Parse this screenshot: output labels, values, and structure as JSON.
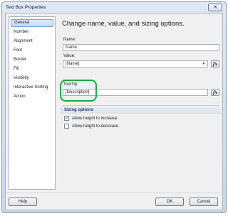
{
  "window": {
    "title": "Text Box Properties",
    "close_glyph": "✕"
  },
  "sidebar": {
    "items": [
      {
        "label": "General",
        "selected": true
      },
      {
        "label": "Number"
      },
      {
        "label": "Alignment"
      },
      {
        "label": "Font"
      },
      {
        "label": "Border"
      },
      {
        "label": "Fill"
      },
      {
        "label": "Visibility"
      },
      {
        "label": "Interactive Sorting"
      },
      {
        "label": "Action"
      }
    ]
  },
  "general": {
    "heading": "Change name, value, and sizing options.",
    "name_label": "Name:",
    "name_value": "Name",
    "value_label": "Value:",
    "value_value": "[Name]",
    "tooltip_label": "ToolTip:",
    "tooltip_value": "[Description]",
    "expression_button": "fx",
    "dropdown_arrow": "▼"
  },
  "sizing": {
    "title": "Sizing options",
    "allow_increase_label": "Allow height to increase",
    "allow_increase_checked": true,
    "allow_decrease_label": "Allow height to decrease",
    "allow_decrease_checked": false,
    "check_glyph": "✓"
  },
  "footer": {
    "help_label": "Help",
    "ok_label": "OK",
    "cancel_label": "Cancel"
  },
  "colors": {
    "highlight_annotation": "#1fa846",
    "selection_bg": "#c1dcfb",
    "section_title": "#1f3c6b"
  }
}
